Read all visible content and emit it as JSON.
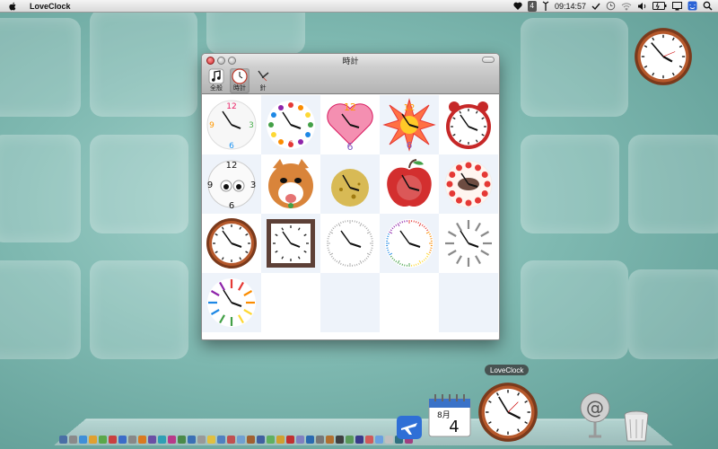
{
  "menubar": {
    "app_name": "LoveClock",
    "badge_number": "4",
    "time": "09:14:57",
    "icons": [
      "apple-icon",
      "heart-icon",
      "antenna-icon",
      "timemachine-icon",
      "wifi-icon",
      "volume-icon",
      "battery-icon",
      "spotlight-icon"
    ]
  },
  "window": {
    "title": "時計",
    "toolbar": [
      {
        "label": "全般",
        "icon": "music-note-icon",
        "selected": false
      },
      {
        "label": "時計",
        "icon": "clock-icon",
        "selected": true
      },
      {
        "label": "針",
        "icon": "hands-icon",
        "selected": false
      }
    ],
    "clocks": [
      "colorful-numbers-clock",
      "dotted-rainbow-clock",
      "pink-heart-clock",
      "star-burst-clock",
      "red-alarm-clock",
      "eyes-clock",
      "shiba-dog-clock",
      "crescent-moon-clock",
      "red-apple-clock",
      "strawberry-cake-clock",
      "brown-wood-round-clock",
      "brown-square-clock",
      "gray-ticks-clock",
      "rainbow-ticks-clock",
      "gray-bars-clock",
      "rainbow-rays-clock"
    ]
  },
  "dock": {
    "tooltip": "LoveClock",
    "calendar": {
      "month": "8月",
      "day": "4"
    },
    "colors": {
      "accent": "#a0522d",
      "shelf": "#dfeeee"
    }
  }
}
